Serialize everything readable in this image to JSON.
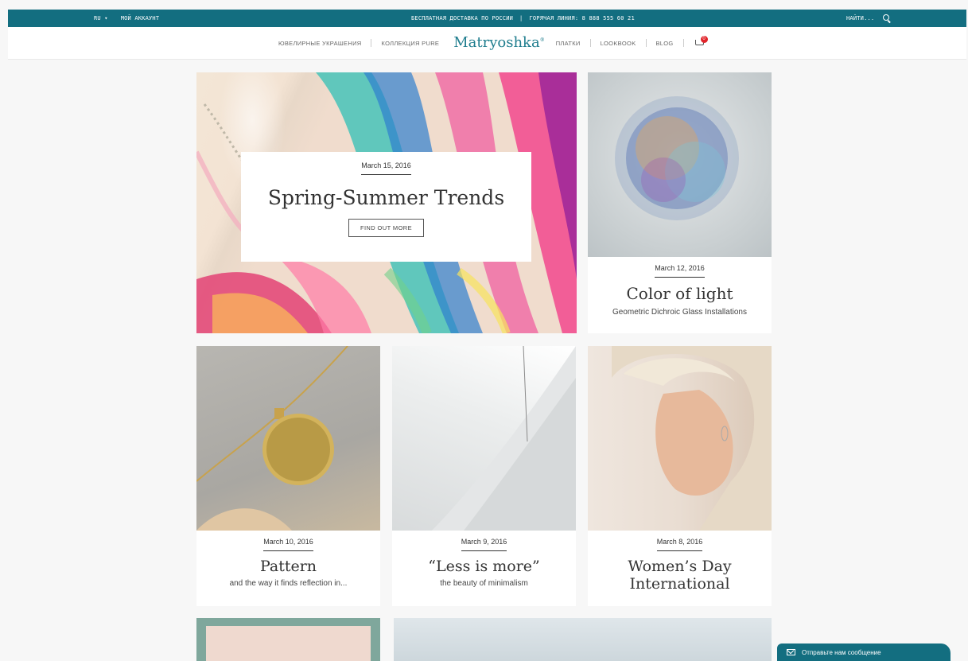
{
  "topbar": {
    "lang": "RU",
    "account": "МОЙ АККАУНТ",
    "shipping": "БЕСПЛАТНАЯ ДОСТАВКА ПО РОССИИ",
    "divider": "|",
    "hotline": "ГОРЯЧАЯ ЛИНИЯ: 8 888 555 60 21",
    "search_placeholder": "НАЙТИ..."
  },
  "nav": {
    "jewelry": "ЮВЕЛИРНЫЕ УКРАШЕНИЯ",
    "pure": "КОЛЛЕКЦИЯ PURE",
    "logo": "Matryoshka",
    "logo_mark": "®",
    "scarves": "ПЛАТКИ",
    "lookbook": "LOOKBOOK",
    "blog": "BLOG",
    "cart_count": "0"
  },
  "posts": {
    "hero": {
      "date": "March 15, 2016",
      "title": "Spring-Summer Trends",
      "button": "FIND OUT MORE"
    },
    "color": {
      "date": "March 12, 2016",
      "title": "Color of light",
      "subtitle": "Geometric Dichroic Glass Installations"
    },
    "pattern": {
      "date": "March 10, 2016",
      "title": "Pattern",
      "subtitle": "and the way it finds reflection in..."
    },
    "less": {
      "date": "March 9, 2016",
      "title": "“Less is more”",
      "subtitle": "the beauty of minimalism"
    },
    "women": {
      "date": "March 8, 2016",
      "title": "Women’s Day International"
    }
  },
  "chat": {
    "label": "Отправьте нам сообщение"
  },
  "colors": {
    "brand": "#136e80",
    "logo": "#1f7d8e",
    "badge": "#e1252b"
  }
}
